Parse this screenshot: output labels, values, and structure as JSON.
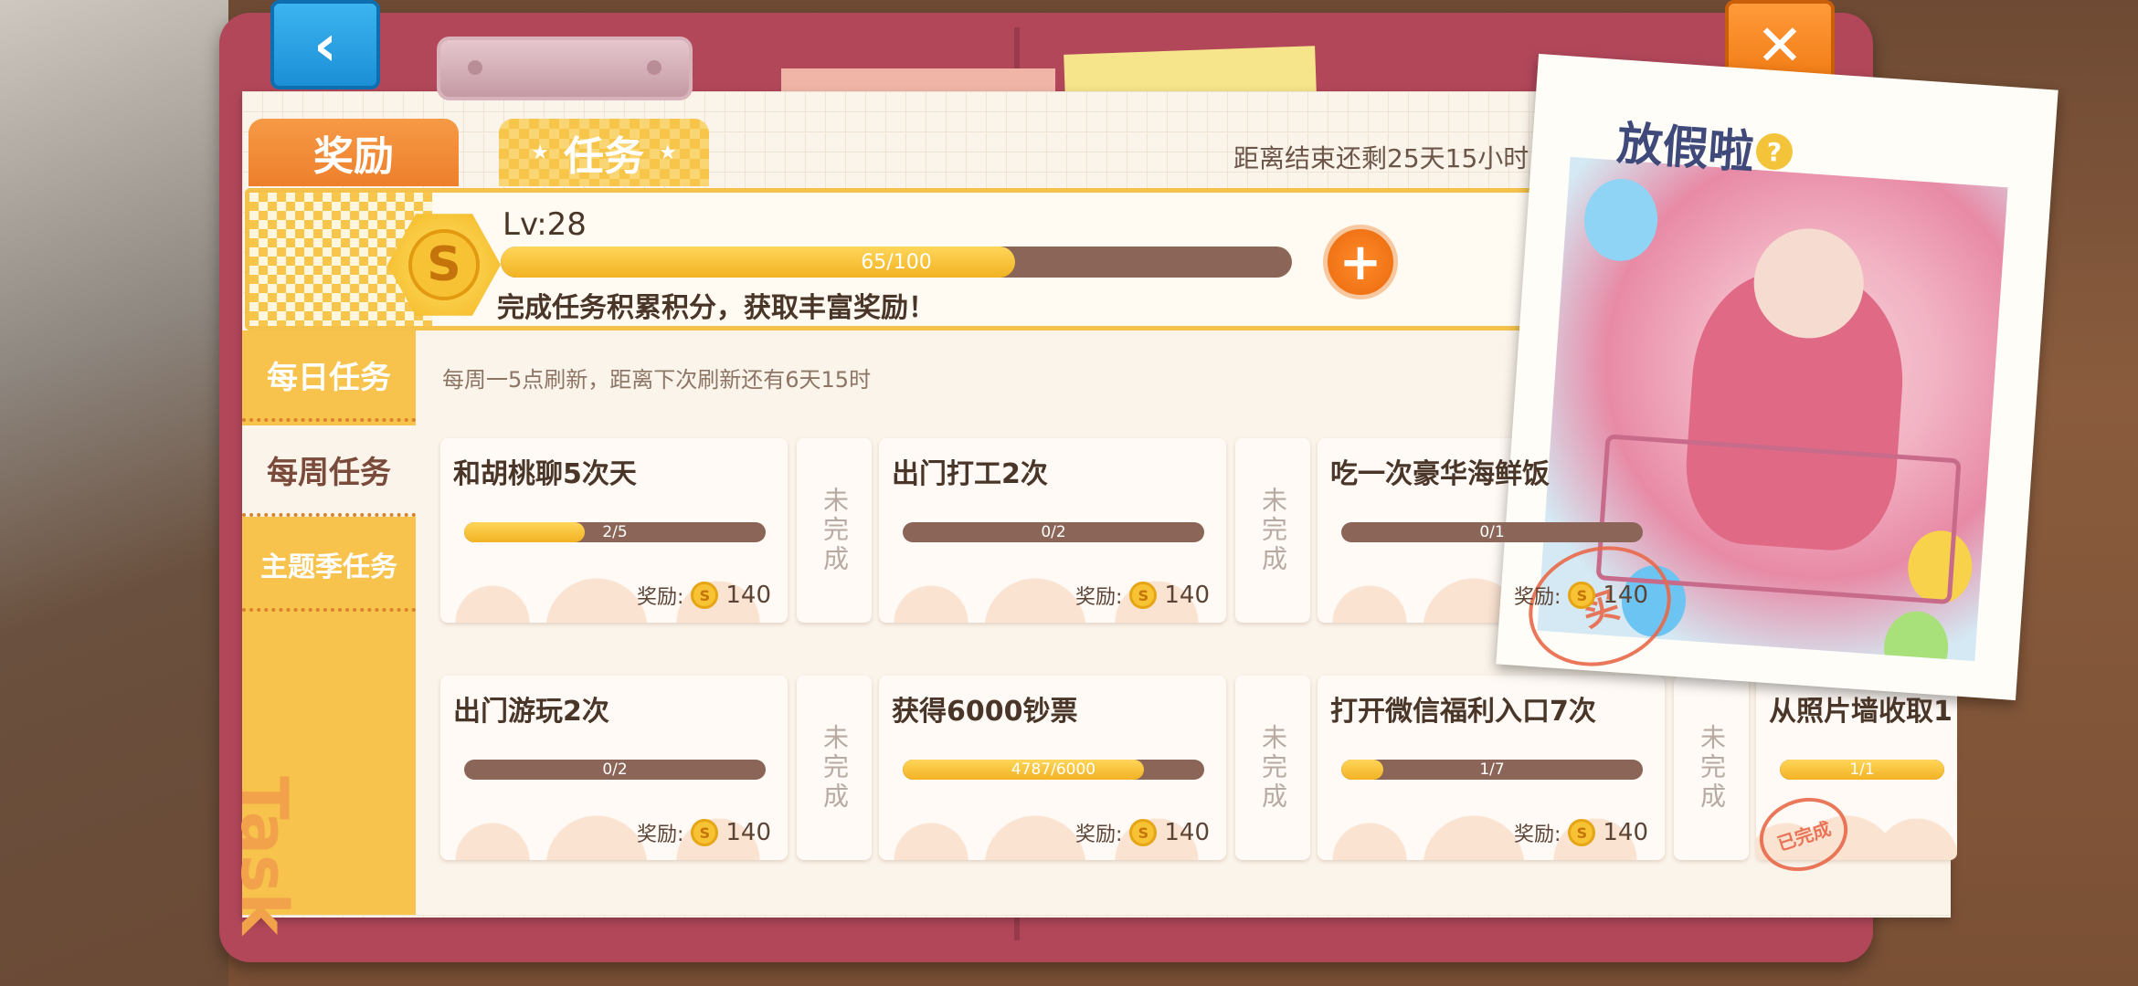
{
  "nav": {
    "back_icon": "‹",
    "close_icon": "✕"
  },
  "tabs": [
    {
      "label": "奖励"
    },
    {
      "label": "任务"
    }
  ],
  "countdown": "距离结束还剩25天15小时",
  "level": {
    "label": "Lv:28",
    "progress_text": "65/100",
    "progress_value": 0.65,
    "description": "完成任务积累积分，获取丰富奖励！",
    "coin_icon_text": "S",
    "plus_label": "+"
  },
  "sidebar": [
    {
      "label": "每日任务",
      "active": false
    },
    {
      "label": "每周任务",
      "active": true
    },
    {
      "label": "主题季任务",
      "active": false
    }
  ],
  "watermark": "Task",
  "refresh_note": "每周一5点刷新，距离下次刷新还有6天15时",
  "tasks": [
    {
      "title": "和胡桃聊5次天",
      "progress": "2/5",
      "fraction": 0.4,
      "reward_label": "奖励:",
      "reward": "140",
      "status": "未完成"
    },
    {
      "title": "出门打工2次",
      "progress": "0/2",
      "fraction": 0.0,
      "reward_label": "奖励:",
      "reward": "140",
      "status": "未完成"
    },
    {
      "title": "吃一次豪华海鲜饭",
      "progress": "0/1",
      "fraction": 0.0,
      "reward_label": "奖励:",
      "reward": "140",
      "status": ""
    },
    {
      "title": "出门游玩2次",
      "progress": "0/2",
      "fraction": 0.0,
      "reward_label": "奖励:",
      "reward": "140",
      "status": "未完成"
    },
    {
      "title": "获得6000钞票",
      "progress": "4787/6000",
      "fraction": 0.8,
      "reward_label": "奖励:",
      "reward": "140",
      "status": "未完成"
    },
    {
      "title": "打开微信福利入口7次",
      "progress": "1/7",
      "fraction": 0.14,
      "reward_label": "奖励:",
      "reward": "140",
      "status": "未完成"
    },
    {
      "title": "从照片墙收取1",
      "progress": "1/1",
      "fraction": 1.0,
      "reward_label": "",
      "reward": "",
      "status": ""
    }
  ],
  "stamps": {
    "completed": "已完成",
    "buy": "买"
  },
  "event": {
    "title": "放假啦",
    "help_label": "?"
  },
  "colors": {
    "accent_orange": "#ee7f2c",
    "accent_yellow": "#f7c34c",
    "folder_red": "#b2475a",
    "bar_track": "#8b6658"
  }
}
